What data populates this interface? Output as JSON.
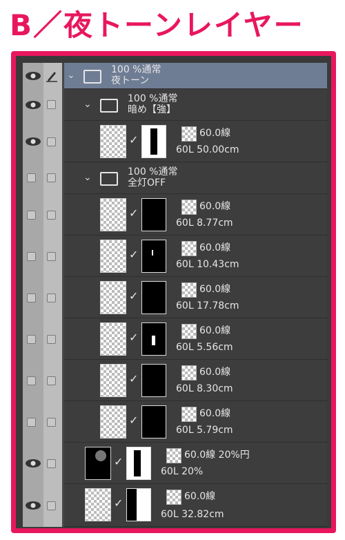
{
  "title": "B／夜トーンレイヤー",
  "layers": [
    {
      "line1": "100 %通常",
      "line2": "夜トーン"
    },
    {
      "line1": "100 %通常",
      "line2": "暗め【強】"
    },
    {
      "mode": "60.0線",
      "size": "60L 50.00cm"
    },
    {
      "line1": "100 %通常",
      "line2": "全灯OFF"
    },
    {
      "mode": "60.0線",
      "size": "60L 8.77cm"
    },
    {
      "mode": "60.0線",
      "size": "60L 10.43cm"
    },
    {
      "mode": "60.0線",
      "size": "60L 17.78cm"
    },
    {
      "mode": "60.0線",
      "size": "60L 5.56cm"
    },
    {
      "mode": "60.0線",
      "size": "60L 8.30cm"
    },
    {
      "mode": "60.0線",
      "size": "60L 5.79cm"
    },
    {
      "mode": "60.0線 20%円",
      "size": "60L 20%"
    },
    {
      "mode": "60.0線",
      "size": "60L 32.82cm"
    }
  ]
}
